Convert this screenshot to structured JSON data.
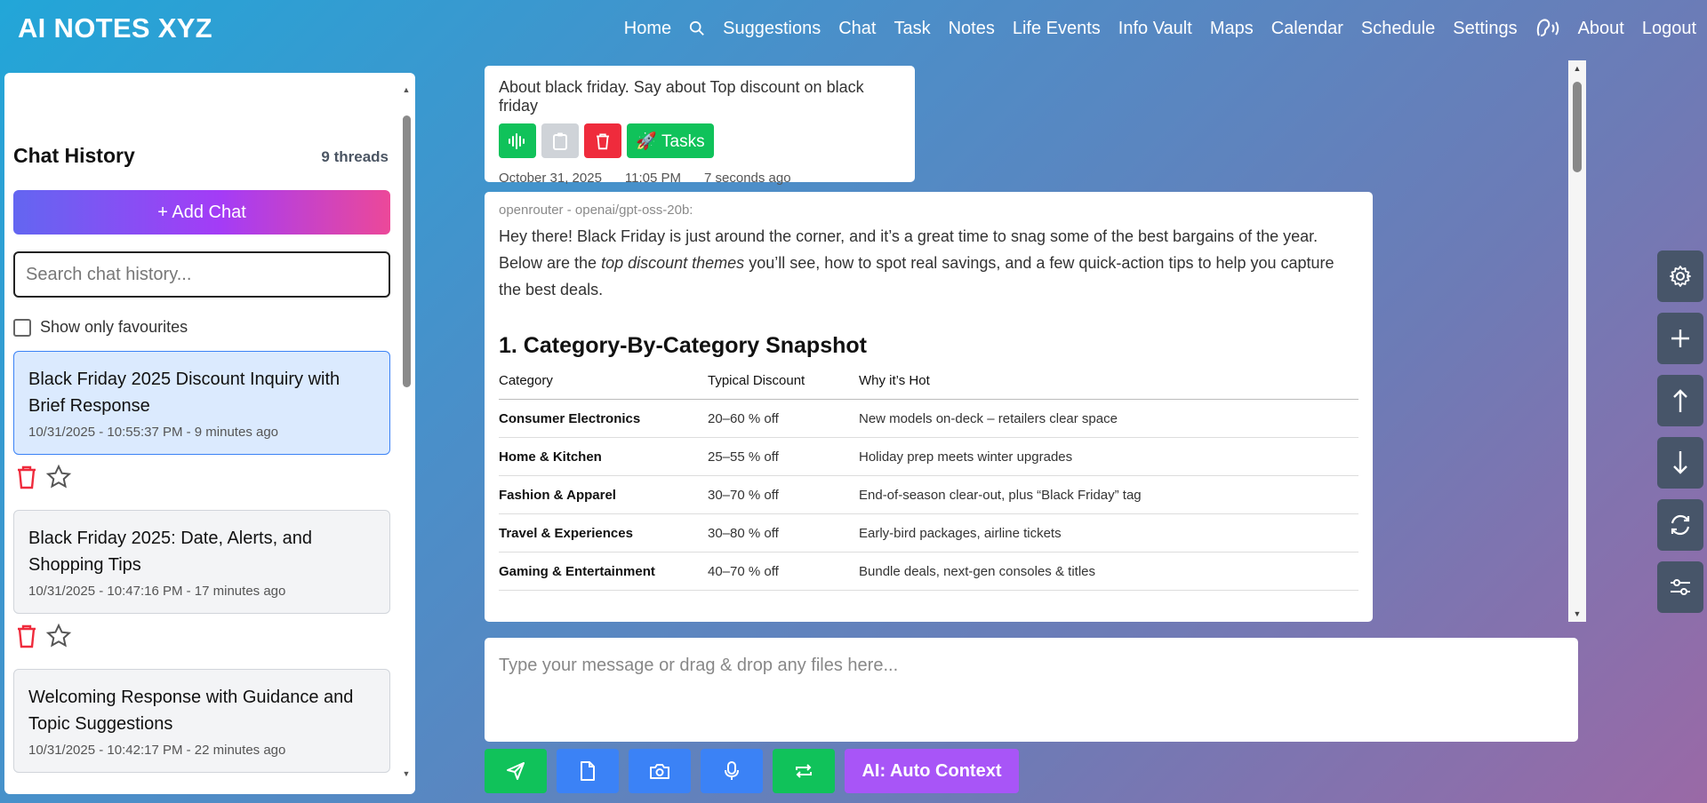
{
  "app": {
    "brand": "AI NOTES XYZ"
  },
  "nav": {
    "home": "Home",
    "suggestions": "Suggestions",
    "chat": "Chat",
    "task": "Task",
    "notes": "Notes",
    "life_events": "Life Events",
    "info_vault": "Info Vault",
    "maps": "Maps",
    "calendar": "Calendar",
    "schedule": "Schedule",
    "settings": "Settings",
    "about": "About",
    "logout": "Logout",
    "icons": [
      "search-icon",
      "voice-icon"
    ]
  },
  "sidebar": {
    "title": "Chat History",
    "count": "9 threads",
    "add_label": "+ Add Chat",
    "search_placeholder": "Search chat history...",
    "fav_label": "Show only favourites",
    "threads": [
      {
        "title": "Black Friday 2025 Discount Inquiry with Brief Response",
        "meta": "10/31/2025 - 10:55:37 PM - 9 minutes ago",
        "active": true
      },
      {
        "title": "Black Friday 2025: Date, Alerts, and Shopping Tips",
        "meta": "10/31/2025 - 10:47:16 PM - 17 minutes ago",
        "active": false
      },
      {
        "title": "Welcoming Response with Guidance and Topic Suggestions",
        "meta": "10/31/2025 - 10:42:17 PM - 22 minutes ago",
        "active": false
      }
    ]
  },
  "user_message": {
    "text": "About black friday. Say about Top discount on black friday",
    "tasks_label": "🚀 Tasks",
    "date": "October 31, 2025",
    "time": "11:05 PM",
    "ago": "7 seconds ago"
  },
  "bot_message": {
    "model": "openrouter - openai/gpt-oss-20b:",
    "intro_1": "Hey there! Black Friday is just around the corner, and it’s a great time to snag some of the best bargains of the year. Below are the ",
    "intro_em": "top discount themes",
    "intro_2": " you’ll see, how to spot real savings, and a few quick-action tips to help you capture the best deals.",
    "heading": "1. Category-By-Category Snapshot",
    "table": {
      "headers": [
        "Category",
        "Typical Discount",
        "Why it’s Hot"
      ],
      "rows": [
        [
          "Consumer Electronics",
          "20–60 % off",
          "New models on-deck – retailers clear space"
        ],
        [
          "Home & Kitchen",
          "25–55 % off",
          "Holiday prep meets winter upgrades"
        ],
        [
          "Fashion & Apparel",
          "30–70 % off",
          "End-of-season clear-out, plus “Black Friday” tag"
        ],
        [
          "Travel & Experiences",
          "30–80 % off",
          "Early-bird packages, airline tickets"
        ],
        [
          "Gaming & Entertainment",
          "40–70 % off",
          "Bundle deals, next-gen consoles & titles"
        ]
      ]
    }
  },
  "composer": {
    "placeholder": "Type your message or drag & drop any files here..."
  },
  "bottom_bar": {
    "ai_label": "AI: Auto Context"
  },
  "colors": {
    "green": "#10c25a",
    "red": "#ef2b3c",
    "blue": "#3b82f6",
    "purple": "#a855f7",
    "slate": "#475569"
  }
}
